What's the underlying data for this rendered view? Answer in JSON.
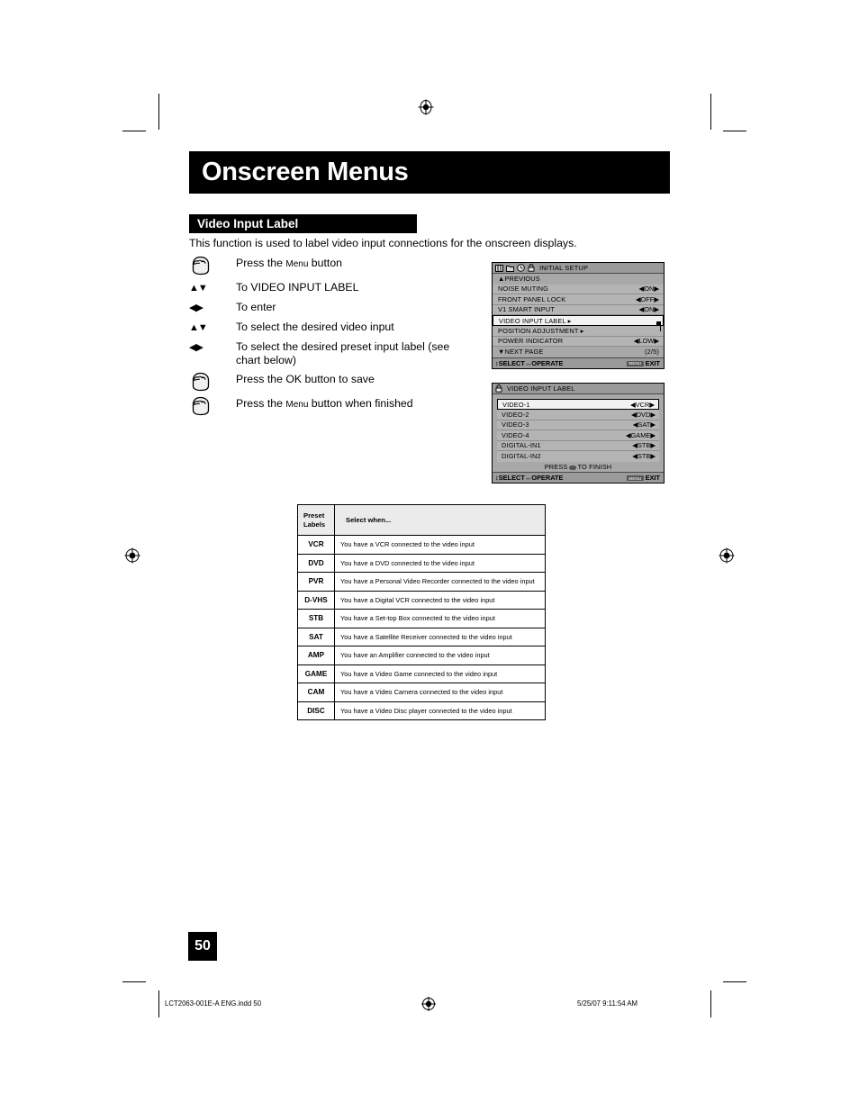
{
  "page": {
    "title": "Onscreen Menus",
    "section": "Video Input Label",
    "intro": "This function is used to label video input connections for the onscreen displays.",
    "number": "50"
  },
  "steps": [
    {
      "icon": "hand-press-icon",
      "text_pre": "Press the ",
      "text_sc": "Menu",
      "text_post": " button"
    },
    {
      "icon": "up-down-arrows-icon",
      "text_pre": "To VIDEO INPUT LABEL",
      "text_sc": "",
      "text_post": ""
    },
    {
      "icon": "left-right-arrows-icon",
      "text_pre": "To enter",
      "text_sc": "",
      "text_post": ""
    },
    {
      "icon": "up-down-arrows-icon",
      "text_pre": "To select the desired video input",
      "text_sc": "",
      "text_post": ""
    },
    {
      "icon": "left-right-arrows-icon",
      "text_pre": "To select the desired preset input label (see chart below)",
      "text_sc": "",
      "text_post": ""
    },
    {
      "icon": "hand-press-icon",
      "text_pre": "Press the OK button to save",
      "text_sc": "",
      "text_post": ""
    },
    {
      "icon": "hand-press-icon",
      "text_pre": "Press the ",
      "text_sc": "Menu",
      "text_post": " button when finished"
    }
  ],
  "osd_initial_setup": {
    "title": "INITIAL SETUP",
    "icons": [
      "display-grid-icon",
      "folder-icon",
      "clock-icon",
      "lock-icon"
    ],
    "nav_prev": "PREVIOUS",
    "rows": [
      {
        "label": "NOISE MUTING",
        "value": "ON",
        "selected": false,
        "submenu": false
      },
      {
        "label": "FRONT PANEL LOCK",
        "value": "OFF",
        "selected": false,
        "submenu": false
      },
      {
        "label": "V1 SMART INPUT",
        "value": "ON",
        "selected": false,
        "submenu": false
      },
      {
        "label": "VIDEO INPUT LABEL",
        "value": "",
        "selected": true,
        "submenu": true
      },
      {
        "label": "POSITION ADJUSTMENT",
        "value": "",
        "selected": false,
        "submenu": true
      },
      {
        "label": "POWER INDICATOR",
        "value": "LOW",
        "selected": false,
        "submenu": false
      }
    ],
    "nav_next": "NEXT PAGE",
    "page_counter": "(2/5)",
    "footer_select": "SELECT",
    "footer_operate": "OPERATE",
    "footer_exit": "EXIT",
    "footer_exit_key": "MENU"
  },
  "osd_video_input_label": {
    "title": "VIDEO INPUT LABEL",
    "icon": "lock-icon",
    "rows": [
      {
        "label": "VIDEO-1",
        "value": "VCR",
        "selected": true
      },
      {
        "label": "VIDEO-2",
        "value": "DVD",
        "selected": false
      },
      {
        "label": "VIDEO-3",
        "value": "SAT",
        "selected": false
      },
      {
        "label": "VIDEO-4",
        "value": "GAME",
        "selected": false
      },
      {
        "label": "DIGITAL-IN1",
        "value": "STB",
        "selected": false
      },
      {
        "label": "DIGITAL-IN2",
        "value": "STB",
        "selected": false
      }
    ],
    "hint_pre": "PRESS",
    "hint_post": "TO FINISH",
    "footer_select": "SELECT",
    "footer_operate": "OPERATE",
    "footer_exit": "EXIT",
    "footer_exit_key": "MENU"
  },
  "preset_table": {
    "header": {
      "col1_line1": "Preset",
      "col1_line2": "Labels",
      "col2": "Select when..."
    },
    "rows": [
      {
        "label": "VCR",
        "desc": "You have a VCR connected to the video input"
      },
      {
        "label": "DVD",
        "desc": "You have a DVD connected to the video input"
      },
      {
        "label": "PVR",
        "desc": "You have a Personal Video Recorder connected to the video input"
      },
      {
        "label": "D-VHS",
        "desc": "You have a Digital VCR connected to the video input"
      },
      {
        "label": "STB",
        "desc": "You have a Set-top Box connected to the video input"
      },
      {
        "label": "SAT",
        "desc": "You have a Satellite Receiver connected to the video input"
      },
      {
        "label": "AMP",
        "desc": "You have an Amplifier connected to the video input"
      },
      {
        "label": "GAME",
        "desc": "You have a Video Game connected to the video input"
      },
      {
        "label": "CAM",
        "desc": "You have a Video Camera connected to the video input"
      },
      {
        "label": "DISC",
        "desc": "You have a Video Disc player connected to the video input"
      }
    ]
  },
  "footer": {
    "file": "LCT2063-001E-A ENG.indd   50",
    "timestamp": "5/25/07   9:11:54 AM"
  }
}
